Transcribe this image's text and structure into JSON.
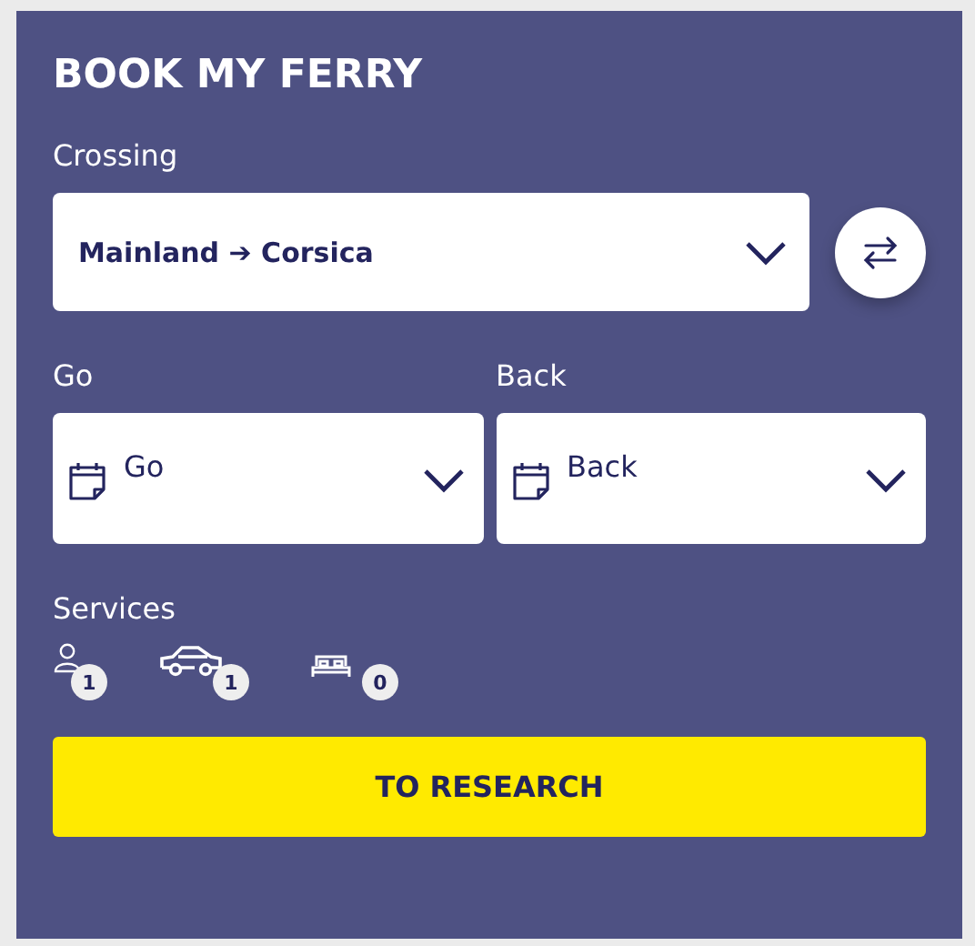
{
  "title": "BOOK MY FERRY",
  "crossing": {
    "label": "Crossing",
    "value": "Mainland ➔ Corsica"
  },
  "dates": [
    {
      "label": "Go",
      "placeholder": "Go"
    },
    {
      "label": "Back",
      "placeholder": "Back"
    }
  ],
  "services": {
    "label": "Services",
    "items": [
      {
        "kind": "person",
        "count": "1"
      },
      {
        "kind": "car",
        "count": "1"
      },
      {
        "kind": "bed",
        "count": "0"
      }
    ]
  },
  "submit": "TO RESEARCH"
}
